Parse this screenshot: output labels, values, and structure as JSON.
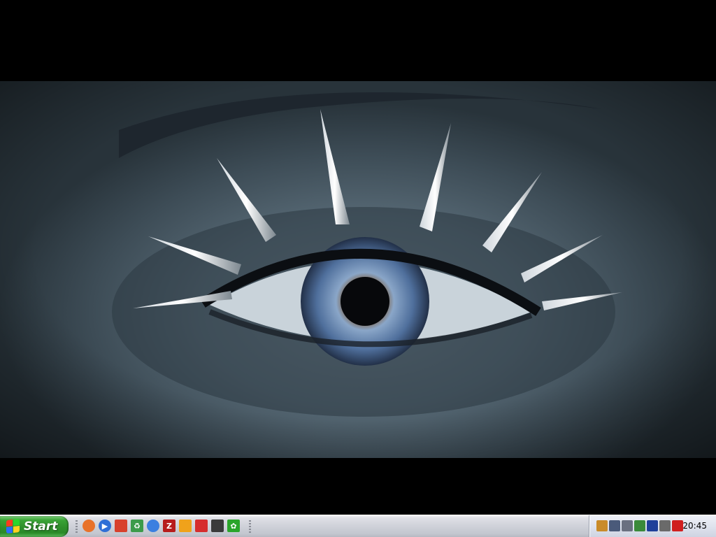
{
  "taskbar": {
    "start_label": "Start",
    "quick_launch": [
      {
        "name": "firefox-icon",
        "glyph": "",
        "color": "#e8722a"
      },
      {
        "name": "media-player-icon",
        "glyph": "▶",
        "color": "#2f6fd6"
      },
      {
        "name": "file-manager-icon",
        "glyph": "",
        "color": "#d8402c"
      },
      {
        "name": "recycle-icon",
        "glyph": "♻",
        "color": "#3c9b4a"
      },
      {
        "name": "globe-icon",
        "glyph": "",
        "color": "#3b7fe0"
      },
      {
        "name": "filezilla-icon",
        "glyph": "Z",
        "color": "#b71c1c"
      },
      {
        "name": "folder-icon",
        "glyph": "",
        "color": "#f0a21b"
      },
      {
        "name": "video-app-icon",
        "glyph": "",
        "color": "#d62d2d"
      },
      {
        "name": "terminal-icon",
        "glyph": "",
        "color": "#3a3a3a"
      },
      {
        "name": "icq-flower-icon",
        "glyph": "✿",
        "color": "#2aa52a"
      }
    ]
  },
  "tray": {
    "icons": [
      {
        "name": "notepad-icon",
        "color": "#c98b2a"
      },
      {
        "name": "network-icon",
        "color": "#4a5a7a"
      },
      {
        "name": "speaker-icon",
        "color": "#6a7080"
      },
      {
        "name": "usb-device-icon",
        "color": "#3a8a3a"
      },
      {
        "name": "app-tray-icon",
        "color": "#1f3f9a"
      },
      {
        "name": "monitor-tray-icon",
        "color": "#6a6a6a"
      },
      {
        "name": "antivirus-icon",
        "color": "#d01f1f"
      }
    ],
    "clock": "20:45"
  }
}
